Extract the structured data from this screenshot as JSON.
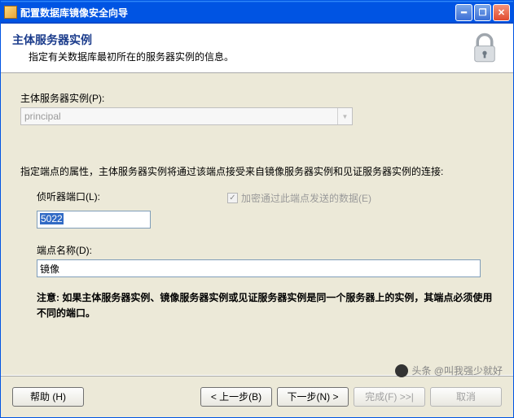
{
  "titlebar": {
    "text": "配置数据库镜像安全向导"
  },
  "header": {
    "title": "主体服务器实例",
    "subtitle": "指定有关数据库最初所在的服务器实例的信息。"
  },
  "form": {
    "principal_label": "主体服务器实例(P):",
    "principal_value": "principal",
    "endpoint_desc": "指定端点的属性，主体服务器实例将通过该端点接受来自镜像服务器实例和见证服务器实例的连接:",
    "listener_label": "侦听器端口(L):",
    "listener_value": "5022",
    "encrypt_label": "加密通过此端点发送的数据(E)",
    "endpoint_name_label": "端点名称(D):",
    "endpoint_name_value": "镜像",
    "note": "注意: 如果主体服务器实例、镜像服务器实例或见证服务器实例是同一个服务器上的实例，其端点必须使用不同的端口。"
  },
  "buttons": {
    "help": "帮助 (H)",
    "back": "< 上一步(B)",
    "next": "下一步(N) >",
    "finish": "完成(F) >>|",
    "cancel": "取消"
  },
  "watermark": "头条 @叫我强少就好"
}
